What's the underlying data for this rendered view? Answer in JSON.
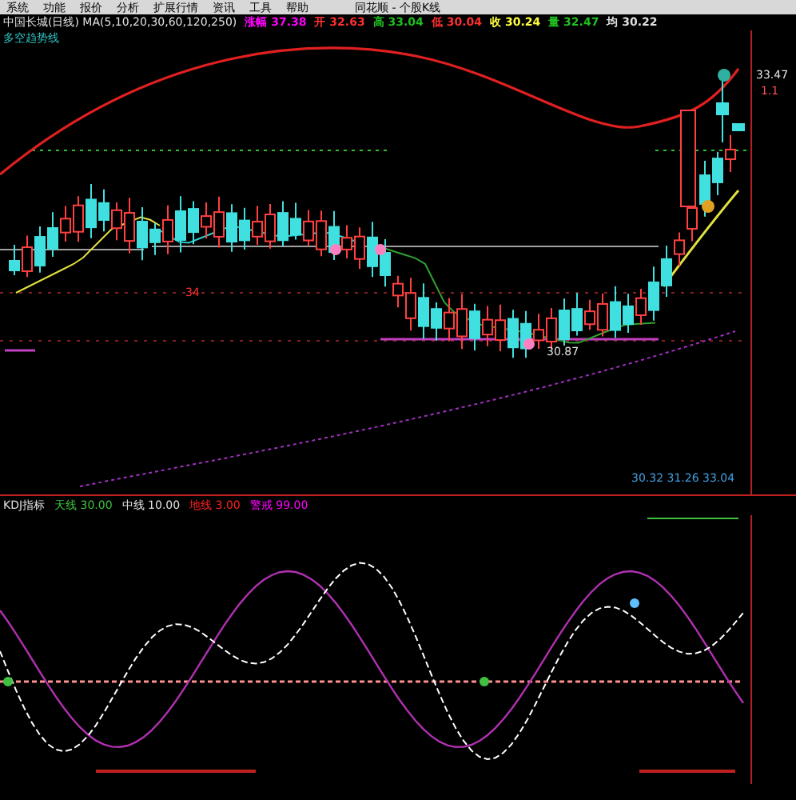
{
  "menu_bar": {
    "items": [
      "系统",
      "功能",
      "报价",
      "分析",
      "扩展行情",
      "资讯",
      "工具",
      "帮助"
    ],
    "title": "同花顺 - 个股K线"
  },
  "info_bar": {
    "title": "中国长城(日线) MA(5,10,20,30,60,120,250)",
    "readouts": [
      {
        "label": "涨幅",
        "value": "37.38",
        "color": "#ff00ff"
      },
      {
        "label": "开",
        "value": "32.63",
        "color": "#ff3030"
      },
      {
        "label": "高",
        "value": "33.04",
        "color": "#20c020"
      },
      {
        "label": "低",
        "value": "30.04",
        "color": "#ff3030"
      },
      {
        "label": "收",
        "value": "30.24",
        "color": "#ffff40"
      },
      {
        "label": "量",
        "value": "32.47",
        "color": "#20c020"
      },
      {
        "label": "均",
        "value": "30.22",
        "color": "#e0e0e0"
      }
    ]
  },
  "main_chart": {
    "subtitle": "多空趋势线",
    "high_label": "33.47",
    "high_note": "1.1",
    "low_label": "30.87",
    "marker": "34",
    "readout": "30.32  31.26  33.04"
  },
  "indicator": {
    "name": "KDJ指标",
    "params": [
      {
        "label": "天线",
        "value": "30.00",
        "color": "#40c040"
      },
      {
        "label": "中线",
        "value": "10.00",
        "color": "#e0e0e0"
      },
      {
        "label": "地线",
        "value": "3.00",
        "color": "#ff2020"
      },
      {
        "label": "警戒",
        "value": "99.00",
        "color": "#ff00ff"
      }
    ]
  }
}
